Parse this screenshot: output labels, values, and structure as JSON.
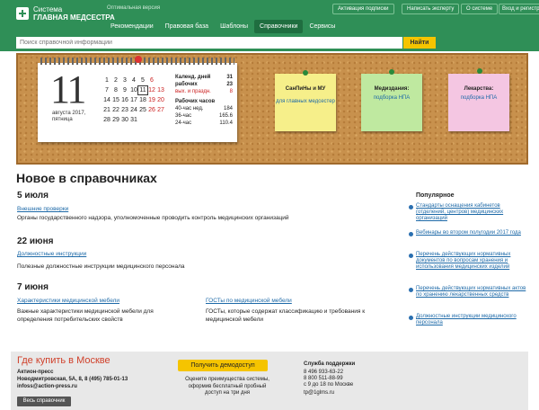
{
  "header": {
    "logo_line1": "Система",
    "logo_line2": "Главная медсестра",
    "optimal_version": "Оптимальная версия",
    "btn_activate": "Активация подписки",
    "btn_expert": "Написать эксперту",
    "btn_about": "О системе",
    "btn_login": "Вход и регистрация",
    "nav": [
      "Рекомендации",
      "Правовая база",
      "Шаблоны",
      "Справочники",
      "Сервисы"
    ],
    "search_placeholder": "Поиск справочной информации",
    "search_button": "Найти"
  },
  "calendar": {
    "big_day": "11",
    "date_line1": "августа 2017,",
    "date_line2": "пятница",
    "grid": [
      "1",
      "2",
      "3",
      "4",
      "5",
      "6",
      "",
      "7",
      "8",
      "9",
      "10",
      "11",
      "12",
      "13",
      "14",
      "15",
      "16",
      "17",
      "18",
      "19",
      "20",
      "21",
      "22",
      "23",
      "24",
      "25",
      "26",
      "27",
      "28",
      "29",
      "30",
      "31",
      "",
      "",
      ""
    ],
    "info": {
      "cal_days_label": "Календ. дней",
      "cal_days": "31",
      "work_days_label": "рабочих",
      "work_days": "23",
      "weekend_label": "вых. и праздн.",
      "weekend": "8",
      "hours_label": "Рабочих часов",
      "h40_label": "40-час нед.",
      "h40": "184",
      "h36_label": "36-час",
      "h36": "165.6",
      "h24_label": "24-час",
      "h24": "110.4"
    }
  },
  "notes": [
    {
      "title": "СанПиНы и МУ",
      "link": "для главных медсестер",
      "color": "#f6ef8a"
    },
    {
      "title": "Медиздания:",
      "link": "подборка НПА",
      "color": "#bfe9a0"
    },
    {
      "title": "Лекарства:",
      "link": "подборка НПА",
      "color": "#f4c6e2"
    }
  ],
  "main": {
    "title": "Новое в справочниках",
    "sections": [
      {
        "date": "5 июля",
        "link": "Внешние проверки",
        "text": "Органы государственного надзора, уполномоченные проводить контроль медицинских организаций"
      },
      {
        "date": "22 июня",
        "link": "Должностные инструкции",
        "text": "Полезные должностные инструкции медицинского персонала"
      },
      {
        "date": "7 июня",
        "link": "Характеристики медицинской мебели",
        "text": "Важные характеристики медицинской мебели для определения потребительских свойств",
        "link2": "ГОСТы по медицинской мебели",
        "text2": "ГОСТы, которые содержат классификацию и требования к медицинской мебели"
      }
    ]
  },
  "popular": {
    "title": "Популярное",
    "items": [
      "Стандарты оснащения кабинетов (отделений, центров) медицинских организаций",
      "Вебинары во втором полугодии 2017 года",
      "Перечень действующих нормативных документов по вопросам хранения и использования медицинских изделий",
      "Перечень действующих нормативных актов по хранению лекарственных средств",
      "Должностные инструкции медицинского персонала"
    ]
  },
  "footer": {
    "title": "Где купить в Москве",
    "company": "Актион-пресс",
    "address": "Новодмитровская, 5А, 8, 8 (495) 785-01-13",
    "email": "infoss@action-press.ru",
    "all_button": "Весь справочник",
    "demo_button": "Получить демодоступ",
    "demo_text1": "Оцените преимущества системы,",
    "demo_text2": "оформив бесплатный пробный",
    "demo_text3": "доступ на три дня",
    "support_title": "Служба поддержки",
    "phone1": "8 496 933-63-22",
    "phone2": "8 800 511-88-99",
    "hours": "с 9 до 18 по Москве",
    "support_email": "tp@1glms.ru"
  }
}
